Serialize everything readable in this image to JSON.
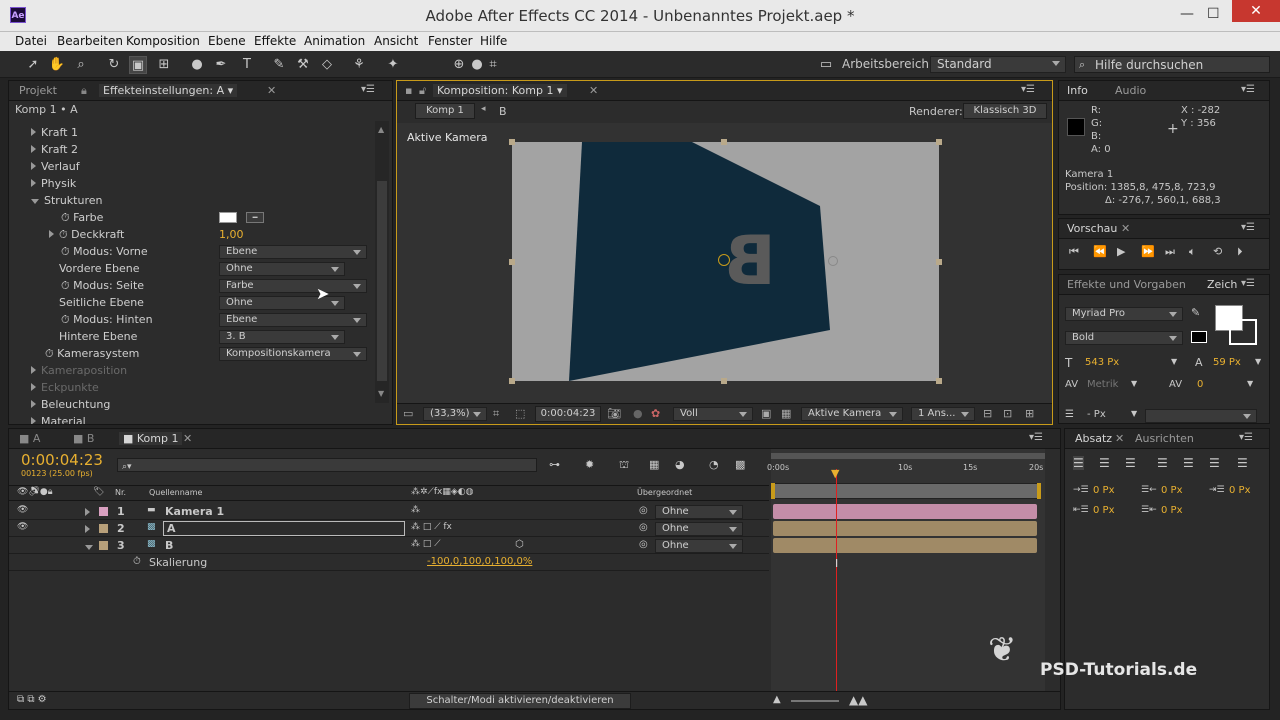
{
  "window": {
    "title": "Adobe After Effects CC 2014 - Unbenanntes Projekt.aep *",
    "app_badge": "Ae",
    "minimize": "—",
    "maximize": "☐",
    "close": "✕"
  },
  "menu": [
    "Datei",
    "Bearbeiten",
    "Komposition",
    "Ebene",
    "Effekte",
    "Animation",
    "Ansicht",
    "Fenster",
    "Hilfe"
  ],
  "toolbar": {
    "workspace_label": "Arbeitsbereich:",
    "workspace_value": "Standard",
    "help_placeholder": "Hilfe durchsuchen"
  },
  "effects_panel": {
    "tab_project": "Projekt",
    "tab_effects": "Effekteinstellungen: A",
    "header": "Komp 1 • A",
    "groups": [
      "Kraft 1",
      "Kraft 2",
      "Verlauf",
      "Physik",
      "Strukturen"
    ],
    "rows": [
      {
        "label": "Farbe"
      },
      {
        "label": "Deckkraft",
        "value": "1,00"
      },
      {
        "label": "Modus: Vorne",
        "value": "Ebene"
      },
      {
        "label": "Vordere Ebene",
        "value": "Ohne"
      },
      {
        "label": "Modus: Seite",
        "value": "Farbe"
      },
      {
        "label": "Seitliche Ebene",
        "value": "Ohne"
      },
      {
        "label": "Modus: Hinten",
        "value": "Ebene"
      },
      {
        "label": "Hintere Ebene",
        "value": "3. B"
      },
      {
        "label": "Kamerasystem",
        "value": "Kompositionskamera"
      }
    ],
    "bottom_groups": [
      "Kameraposition",
      "Eckpunkte",
      "Beleuchtung",
      "Material"
    ]
  },
  "comp_panel": {
    "tab": "Komposition: Komp 1",
    "crumb1": "Komp 1",
    "crumb2": "B",
    "renderer_label": "Renderer:",
    "renderer_value": "Klassisch 3D",
    "camera_label": "Aktive Kamera",
    "layer_letter": "B",
    "footer": {
      "zoom": "(33,3%)",
      "time": "0:00:04:23",
      "quality": "Voll",
      "camera": "Aktive Kamera",
      "views": "1 Ans..."
    }
  },
  "info_panel": {
    "tab_info": "Info",
    "tab_audio": "Audio",
    "r": "R:",
    "g": "G:",
    "b": "B:",
    "a": "A:  0",
    "x": "X : -282",
    "y": "Y : 356",
    "line1": "Kamera 1",
    "line2": "Position: 1385,8, 475,8, 723,9",
    "line3": "Δ: -276,7, 560,1, 688,3"
  },
  "preview_panel": {
    "tab": "Vorschau"
  },
  "effects_presets": {
    "tab": "Effekte und Vorgaben",
    "tab2": "Zeich",
    "font": "Myriad Pro",
    "style": "Bold",
    "size": "543 Px",
    "leading": "59 Px",
    "kerning": "Metrik",
    "tracking": "0",
    "unit": "- Px"
  },
  "paragraph_panel": {
    "tab": "Absatz",
    "tab2": "Ausrichten",
    "indent_vals": [
      "0 Px",
      "0 Px",
      "0 Px",
      "0 Px",
      "0 Px"
    ]
  },
  "timeline": {
    "tabs": [
      "A",
      "B",
      "Komp 1"
    ],
    "timecode": "0:00:04:23",
    "frames": "00123 (25.00 fps)",
    "col_nr": "Nr.",
    "col_source": "Quellenname",
    "col_parent": "Übergeordnet",
    "layers": [
      {
        "nr": "1",
        "name": "Kamera 1",
        "parent": "Ohne"
      },
      {
        "nr": "2",
        "name": "A",
        "parent": "Ohne"
      },
      {
        "nr": "3",
        "name": "B",
        "parent": "Ohne"
      }
    ],
    "property": "Skalierung",
    "property_value": "-100,0,100,0,100,0%",
    "ruler": [
      "0:00s",
      "10s",
      "15s",
      "20s"
    ],
    "footer": "Schalter/Modi aktivieren/deaktivieren"
  },
  "watermark": "PSD-Tutorials.de"
}
